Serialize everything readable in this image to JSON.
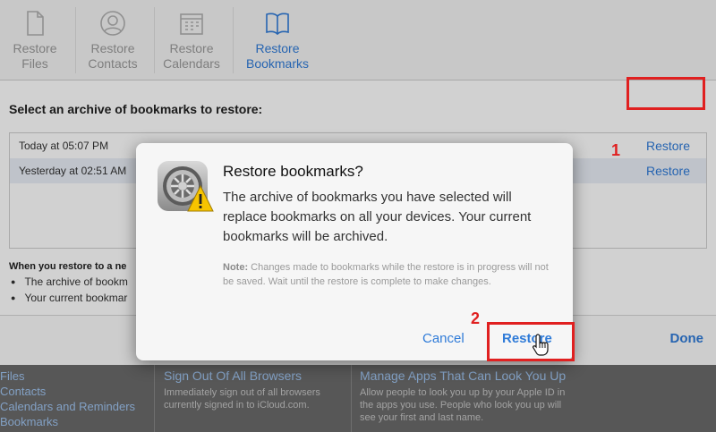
{
  "toolbar": {
    "items": [
      {
        "label1": "Restore",
        "label2": "Files",
        "icon": "file-icon"
      },
      {
        "label1": "Restore",
        "label2": "Contacts",
        "icon": "contact-icon"
      },
      {
        "label1": "Restore",
        "label2": "Calendars",
        "icon": "calendar-icon"
      },
      {
        "label1": "Restore",
        "label2": "Bookmarks",
        "icon": "book-icon"
      }
    ],
    "active_color": "#2f7bd8"
  },
  "main": {
    "select_title": "Select an archive of bookmarks to restore:",
    "archives": [
      {
        "time": "Today at 05:07 PM",
        "action": "Restore"
      },
      {
        "time": "Yesterday at 02:51 AM",
        "action": "Restore"
      }
    ],
    "info_title": "When you restore to a ne",
    "bullets": [
      "The archive of bookm",
      "Your current bookmar"
    ],
    "done_label": "Done"
  },
  "annotations": {
    "step1": "1",
    "step2": "2",
    "color": "#e02020"
  },
  "footer": {
    "links": [
      "Files",
      "Contacts",
      "Calendars and Reminders",
      "Bookmarks"
    ],
    "sign_out": {
      "title": "Sign Out Of All Browsers",
      "desc": "Immediately sign out of all browsers currently signed in to iCloud.com."
    },
    "manage": {
      "title": "Manage Apps That Can Look You Up",
      "desc": "Allow people to look you up by your Apple ID in the apps you use. People who look you up will see your first and last name."
    }
  },
  "dialog": {
    "title": "Restore bookmarks?",
    "message": "The archive of bookmarks you have selected will replace bookmarks on all your devices. Your current bookmarks will be archived.",
    "note_label": "Note:",
    "note_text": " Changes made to bookmarks while the restore is in progress will not be saved. Wait until the restore is complete to make changes.",
    "cancel_label": "Cancel",
    "restore_label": "Restore",
    "icon": "settings-gear-warning-icon"
  }
}
